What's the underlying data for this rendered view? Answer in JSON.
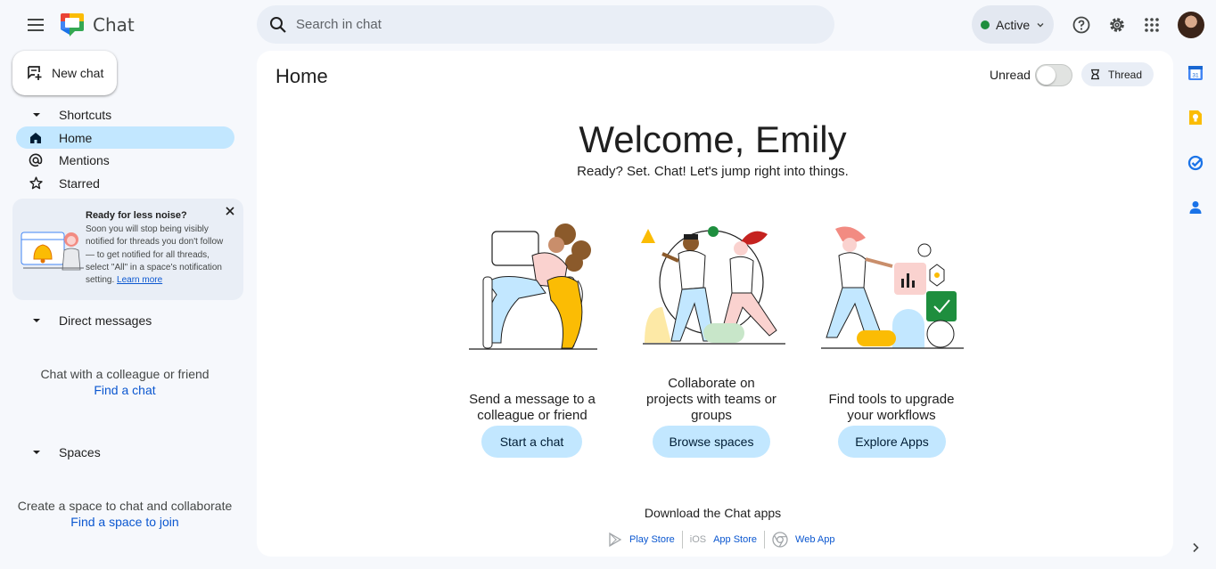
{
  "header": {
    "app_title": "Chat",
    "search_placeholder": "Search in chat",
    "status_label": "Active"
  },
  "sidebar": {
    "new_chat_label": "New chat",
    "shortcuts_label": "Shortcuts",
    "items": [
      {
        "label": "Home",
        "icon": "home-icon",
        "active": true
      },
      {
        "label": "Mentions",
        "icon": "at-icon",
        "active": false
      },
      {
        "label": "Starred",
        "icon": "star-icon",
        "active": false
      }
    ],
    "notice": {
      "title": "Ready for less noise?",
      "body": "Soon you will stop being visibly notified for threads you don't follow — to get notified for all threads, select \"All\" in a space's notification setting.",
      "link": "Learn more"
    },
    "dm": {
      "label": "Direct messages",
      "empty_text": "Chat with a colleague or friend",
      "link": "Find a chat"
    },
    "spaces": {
      "label": "Spaces",
      "empty_text": "Create a space to chat and collaborate",
      "link": "Find a space to join"
    }
  },
  "main": {
    "title": "Home",
    "unread_label": "Unread",
    "unread_on": false,
    "thread_label": "Thread",
    "welcome": "Welcome, Emily",
    "tagline": "Ready? Set. Chat! Let's jump right into things.",
    "cards": [
      {
        "text_line1": "Send a message to a",
        "text_line2": "colleague or friend",
        "button": "Start a chat"
      },
      {
        "text_line1": "Collaborate on",
        "text_line2": "projects with teams or",
        "text_line3": "groups",
        "button": "Browse spaces"
      },
      {
        "text_line1": "Find tools to upgrade",
        "text_line2": "your workflows",
        "button": "Explore Apps"
      }
    ],
    "download_label": "Download the Chat apps",
    "stores": [
      {
        "label": "Play Store",
        "icon": "play-store-icon"
      },
      {
        "label": "App Store",
        "icon": "ios-icon",
        "glyph": "iOS"
      },
      {
        "label": "Web App",
        "icon": "chrome-icon"
      }
    ]
  },
  "colors": {
    "accent": "#0b57d0",
    "active_nav": "#c2e7ff",
    "status_dot": "#1e8e3e",
    "panel_bg": "#ffffff",
    "page_bg": "#f6f8fc"
  }
}
